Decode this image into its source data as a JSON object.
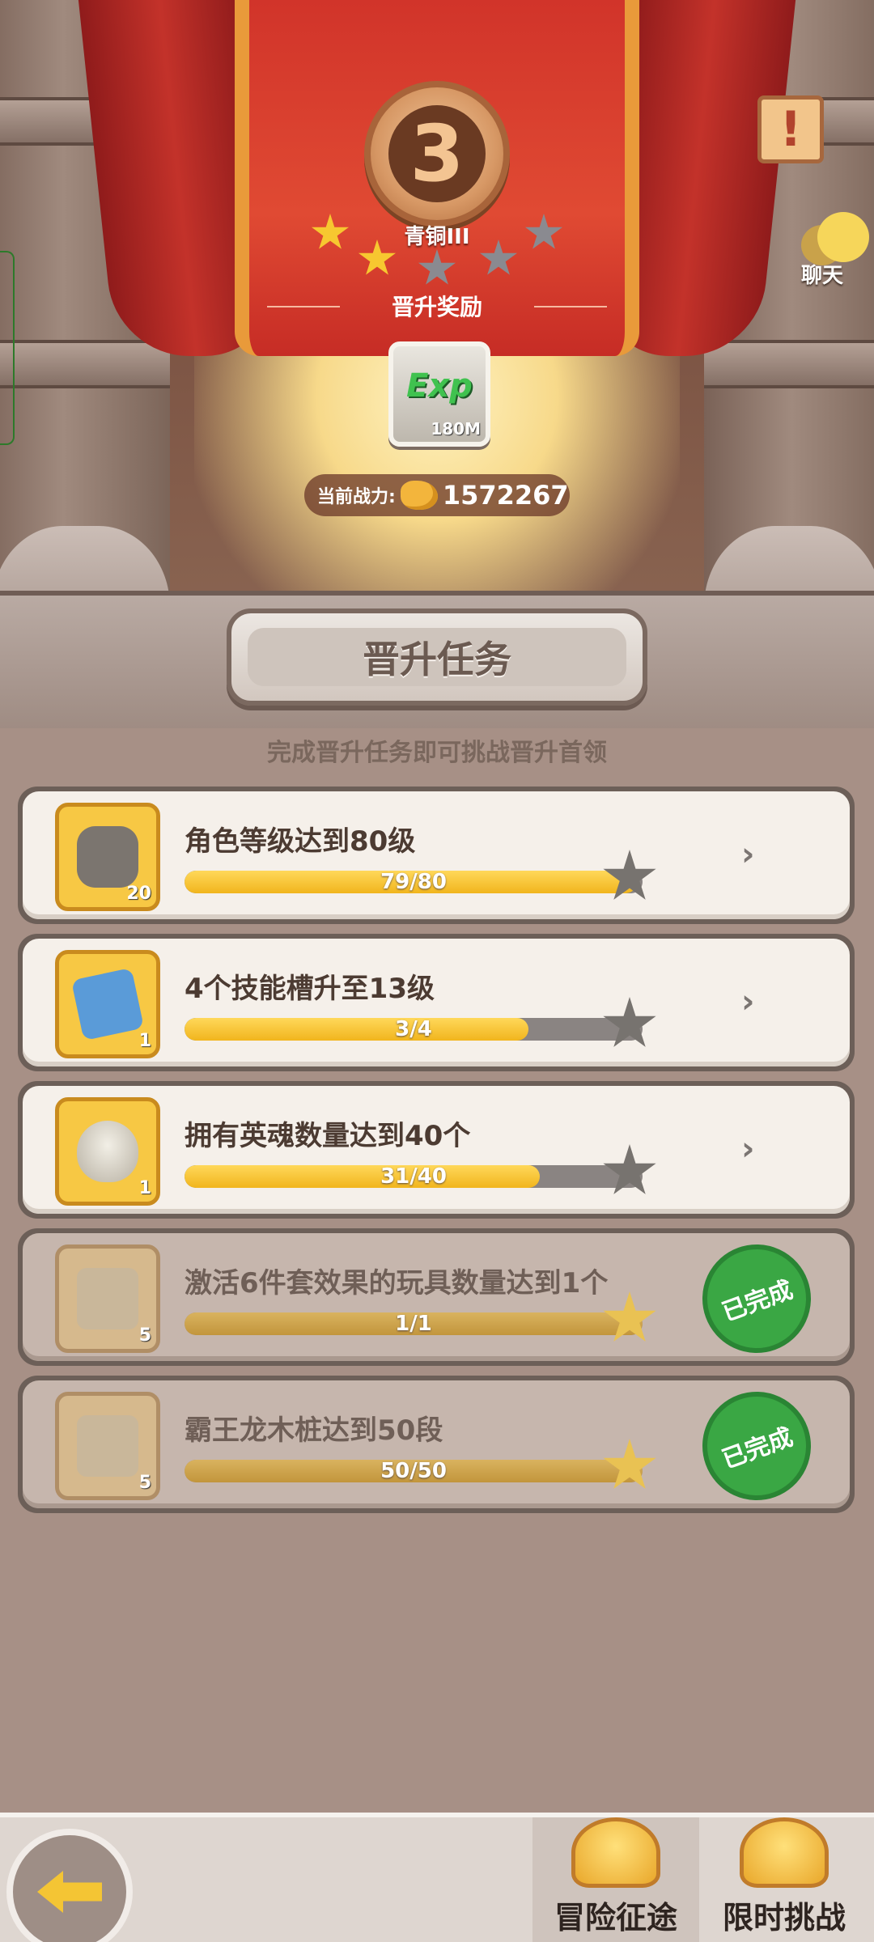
{
  "header": {
    "rank_number": "3",
    "rank_name": "青铜III",
    "reward_title": "晋升奖励",
    "reward_item": {
      "icon": "exp-icon",
      "label": "Exp",
      "amount": "180M"
    },
    "power_label": "当前战力:",
    "power_value": "1572267",
    "stars_filled": 2,
    "stars_total": 5,
    "chat_label": "聊天"
  },
  "section": {
    "title": "晋升任务",
    "subtitle": "完成晋升任务即可挑战晋升首领"
  },
  "tasks": [
    {
      "title": "角色等级达到80级",
      "progress": "79/80",
      "fraction": 0.9875,
      "item_count": "20",
      "icon": "dino-skull-icon",
      "done": false
    },
    {
      "title": "4个技能槽升至13级",
      "progress": "3/4",
      "fraction": 0.75,
      "item_count": "1",
      "icon": "skill-ticket-icon",
      "done": false
    },
    {
      "title": "拥有英魂数量达到40个",
      "progress": "31/40",
      "fraction": 0.775,
      "item_count": "1",
      "icon": "egg-nest-icon",
      "done": false
    },
    {
      "title": "激活6件套效果的玩具数量达到1个",
      "progress": "1/1",
      "fraction": 1.0,
      "item_count": "5",
      "icon": "scroll-icon",
      "done": true
    },
    {
      "title": "霸王龙木桩达到50段",
      "progress": "50/50",
      "fraction": 1.0,
      "item_count": "5",
      "icon": "scroll-icon",
      "done": true
    }
  ],
  "done_stamp": "已完成",
  "bottom_nav": {
    "tab1": "冒险征途",
    "tab2": "限时挑战"
  },
  "colors": {
    "progress_fill": "#f1b51d",
    "done_stamp": "#3aa744",
    "star_gold": "#f7c730"
  }
}
